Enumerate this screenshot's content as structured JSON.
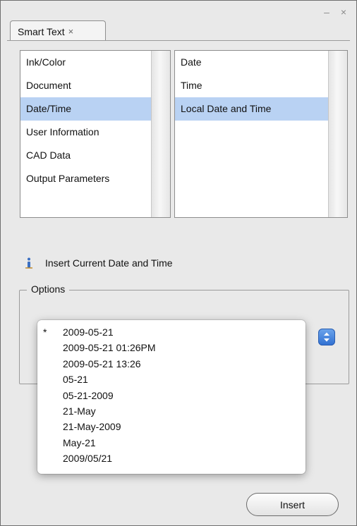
{
  "window": {
    "controls": "– ×"
  },
  "tabs": [
    {
      "label": "Smart Text",
      "close": "×"
    }
  ],
  "categories": {
    "items": [
      {
        "label": "Ink/Color",
        "selected": false
      },
      {
        "label": "Document",
        "selected": false
      },
      {
        "label": "Date/Time",
        "selected": true
      },
      {
        "label": "User Information",
        "selected": false
      },
      {
        "label": "CAD Data",
        "selected": false
      },
      {
        "label": "Output Parameters",
        "selected": false
      }
    ]
  },
  "subitems": {
    "items": [
      {
        "label": "Date",
        "selected": false
      },
      {
        "label": "Time",
        "selected": false
      },
      {
        "label": "Local Date and Time",
        "selected": true
      }
    ]
  },
  "info": {
    "icon": "info-icon",
    "text": "Insert Current Date and Time"
  },
  "options": {
    "legend": "Options",
    "stepper_icon": "updown-arrows-icon",
    "format_menu": [
      {
        "label": "2009-05-21",
        "checked": true
      },
      {
        "label": "2009-05-21 01:26PM",
        "checked": false
      },
      {
        "label": "2009-05-21 13:26",
        "checked": false
      },
      {
        "label": "05-21",
        "checked": false
      },
      {
        "label": "05-21-2009",
        "checked": false
      },
      {
        "label": "21-May",
        "checked": false
      },
      {
        "label": "21-May-2009",
        "checked": false
      },
      {
        "label": "May-21",
        "checked": false
      },
      {
        "label": "2009/05/21",
        "checked": false
      }
    ],
    "check_mark": "*"
  },
  "actions": {
    "insert_label": "Insert"
  },
  "colors": {
    "selection": "#b9d2f3",
    "panel_bg": "#e9e9e9",
    "stepper_blue": "#3a7ad8"
  }
}
